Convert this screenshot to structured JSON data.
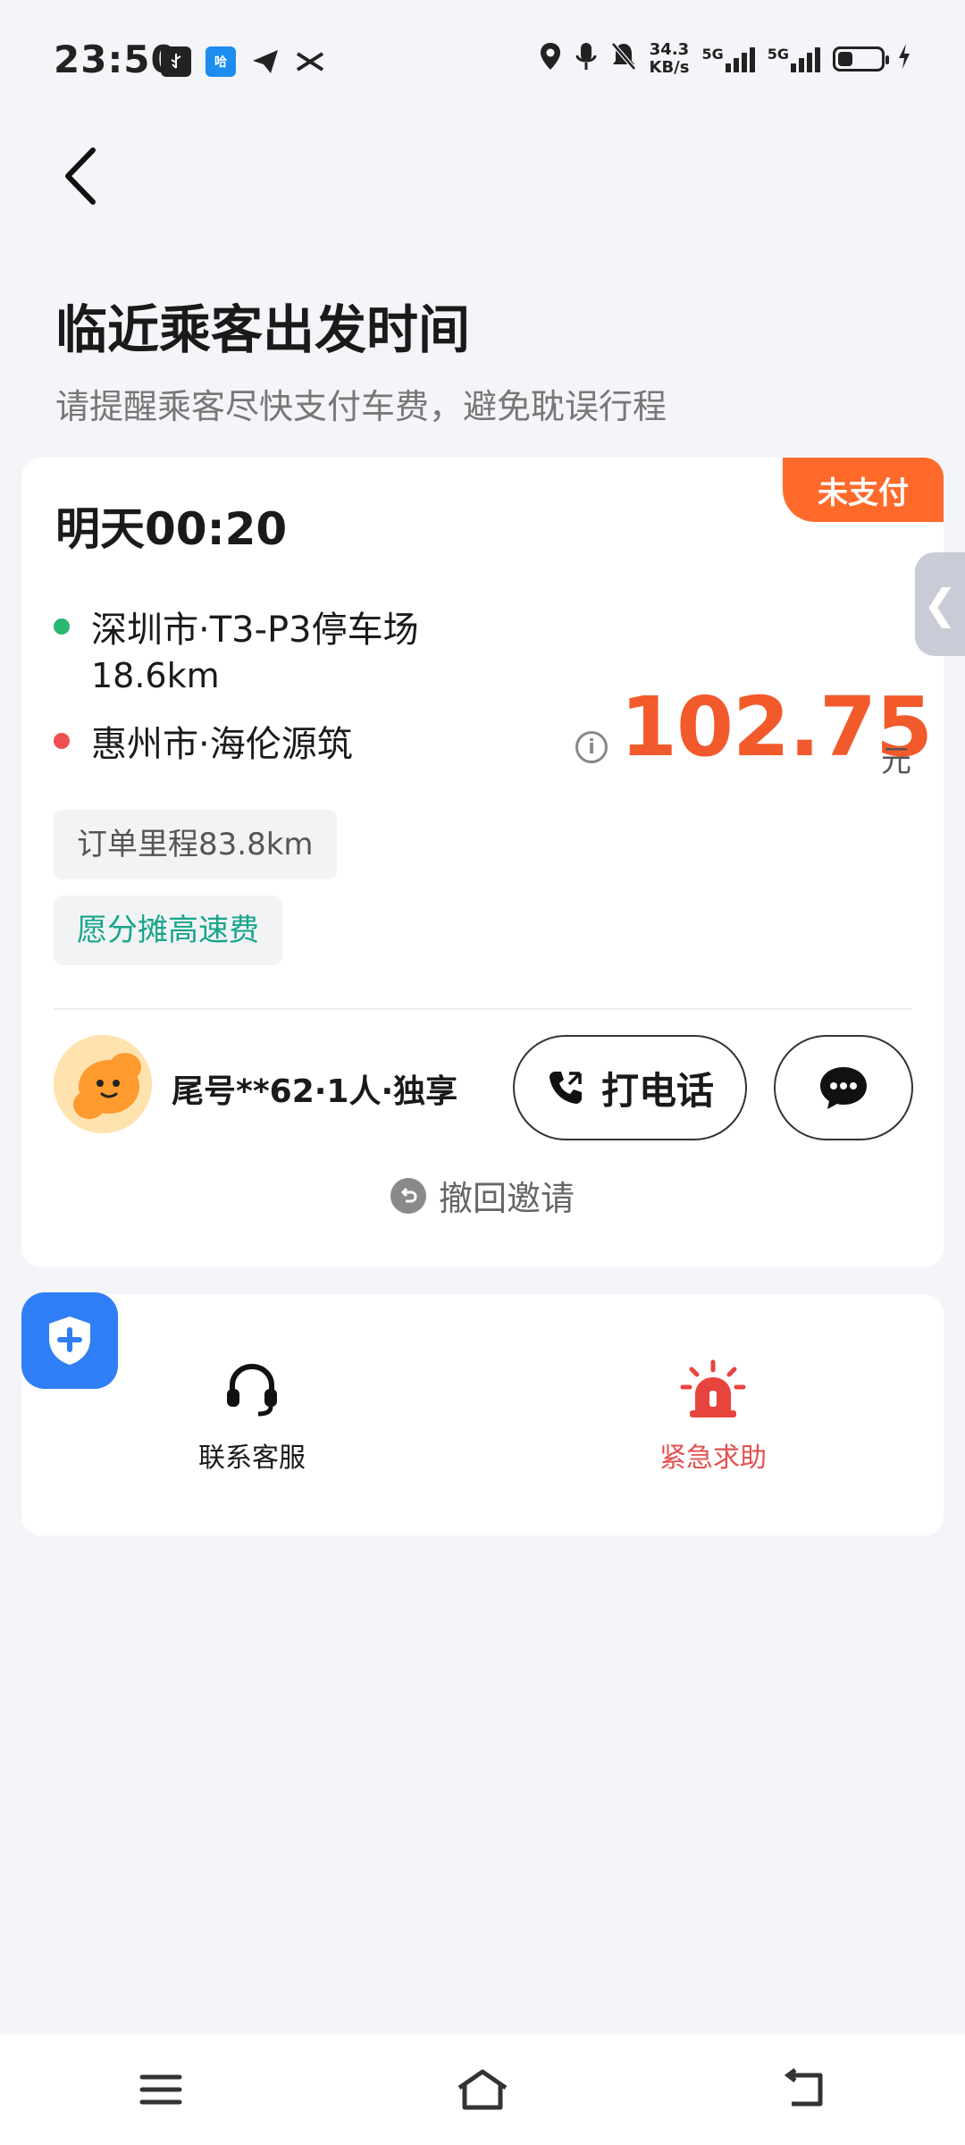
{
  "status_bar": {
    "time": "23:50",
    "app_icons": [
      "usb-debug-icon",
      "hello-app-icon",
      "telegram-icon",
      "x-icon"
    ],
    "right_icons": [
      "location-icon",
      "mic-icon",
      "bell-muted-icon"
    ],
    "net_speed_value": "34.3",
    "net_speed_unit": "KB/s",
    "network_label_1": "5G",
    "network_label_2": "5G",
    "battery_level": 0.35
  },
  "header": {
    "title": "临近乘客出发时间",
    "subtitle": "请提醒乘客尽快支付车费，避免耽误行程"
  },
  "trip": {
    "status_badge": "未支付",
    "date_label": "明天00:20",
    "from": "深圳市·T3-P3停车场",
    "pickup_distance": "18.6km",
    "to": "惠州市·海伦源筑",
    "price": "102.75",
    "currency": "元",
    "info_icon_glyph": "i",
    "order_distance_tag": "订单里程83.8km",
    "toll_tag": "愿分摊高速费",
    "passenger_info": "尾号**62·1人·独享",
    "call_label": "打电话",
    "revoke_label": "撤回邀请"
  },
  "side_tab": {
    "glyph": "❮"
  },
  "services": {
    "customer_service_label": "联系客服",
    "sos_label": "紧急求助"
  },
  "colors": {
    "accent_orange": "#f25a2b",
    "badge_orange": "#ff6a2a",
    "green": "#17a58a",
    "red": "#e55050",
    "blue": "#2f7ef5"
  }
}
